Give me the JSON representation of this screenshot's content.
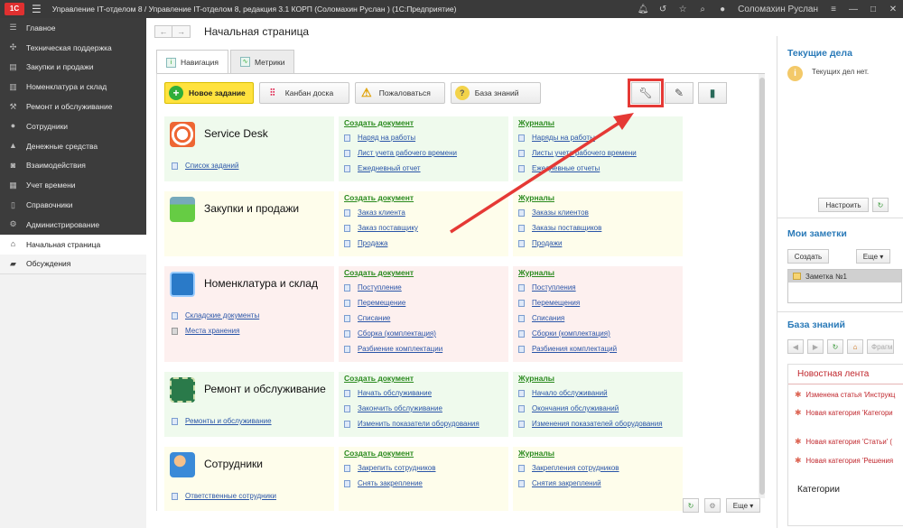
{
  "titlebar": {
    "logo": "1С",
    "title": "Управление IT-отделом 8 / Управление IT-отделом 8, редакция 3.1 КОРП (Соломахин Руслан ) (1С:Предприятие)",
    "user": "Соломахин Руслан",
    "icons": [
      "bell-icon",
      "history-icon",
      "star-icon",
      "search-icon",
      "user-icon",
      "menu-icon",
      "minimize-icon",
      "maximize-icon",
      "close-icon"
    ]
  },
  "sidebar": {
    "items": [
      {
        "label": "Главное",
        "icon": "list-icon"
      },
      {
        "label": "Техническая поддержка",
        "icon": "support-icon"
      },
      {
        "label": "Закупки и продажи",
        "icon": "cart-icon"
      },
      {
        "label": "Номенклатура и склад",
        "icon": "warehouse-icon"
      },
      {
        "label": "Ремонт и обслуживание",
        "icon": "wrench-icon"
      },
      {
        "label": "Сотрудники",
        "icon": "people-icon"
      },
      {
        "label": "Денежные средства",
        "icon": "money-icon"
      },
      {
        "label": "Взаимодействия",
        "icon": "interactions-icon"
      },
      {
        "label": "Учет времени",
        "icon": "calendar-icon"
      },
      {
        "label": "Справочники",
        "icon": "book-icon"
      },
      {
        "label": "Администрирование",
        "icon": "gear-icon"
      },
      {
        "label": "Начальная страница",
        "icon": "home-icon"
      },
      {
        "label": "Обсуждения",
        "icon": "chat-icon"
      }
    ]
  },
  "main": {
    "title": "Начальная страница",
    "tabs": [
      {
        "label": "Навигация"
      },
      {
        "label": "Метрики"
      }
    ],
    "toolbar": {
      "new_task": "Новое задание",
      "kanban": "Канбан доска",
      "complain": "Пожаловаться",
      "knowledge": "База знаний"
    },
    "tools": [
      "wrench-icon",
      "brush-icon",
      "book-icon"
    ],
    "create_doc": "Создать документ",
    "journals": "Журналы",
    "sections": [
      {
        "title": "Service Desk",
        "left_links": [
          "Список заданий"
        ],
        "docs": [
          "Наряд на работы",
          "Лист учета рабочего времени",
          "Ежедневный отчет"
        ],
        "journals": [
          "Наряды на работы",
          "Листы учета рабочего времени",
          "Ежедневные отчеты"
        ]
      },
      {
        "title": "Закупки и продажи",
        "left_links": [],
        "docs": [
          "Заказ клиента",
          "Заказ поставщику",
          "Продажа"
        ],
        "journals": [
          "Заказы клиентов",
          "Заказы поставщиков",
          "Продажи"
        ]
      },
      {
        "title": "Номенклатура и склад",
        "left_links": [
          "Складские документы",
          "Места хранения"
        ],
        "docs": [
          "Поступление",
          "Перемещение",
          "Списание",
          "Сборка (комплектация)",
          "Разбиение комплектации"
        ],
        "journals": [
          "Поступления",
          "Перемещения",
          "Списания",
          "Сборки (комплектация)",
          "Разбиения комплектаций"
        ]
      },
      {
        "title": "Ремонт и обслуживание",
        "left_links": [
          "Ремонты и обслуживание"
        ],
        "docs": [
          "Начать обслуживание",
          "Закончить обслуживание",
          "Изменить показатели оборудования"
        ],
        "journals": [
          "Начало обслуживаний",
          "Окончания обслуживаний",
          "Изменения показателей оборудования"
        ]
      },
      {
        "title": "Сотрудники",
        "left_links": [
          "Ответственные сотрудники"
        ],
        "docs": [
          "Закрепить сотрудников",
          "Снять закрепление"
        ],
        "journals": [
          "Закрепления сотрудников",
          "Снятия закреплений"
        ]
      }
    ],
    "bottom": {
      "more": "Еще ▾"
    }
  },
  "right": {
    "current_tasks": {
      "title": "Текущие дела",
      "empty": "Текущих дел нет.",
      "configure": "Настроить"
    },
    "notes": {
      "title": "Мои заметки",
      "create": "Создать",
      "more": "Еще ▾",
      "items": [
        "Заметка №1"
      ]
    },
    "kb": {
      "title": "База знаний",
      "search_placeholder": "Фрагм",
      "feed_title": "Новостная лента",
      "feed": [
        "Изменена статья 'Инструкц",
        "Новая категория 'Категори",
        "Новая категория 'Статьи' (",
        "Новая категория 'Решения"
      ],
      "categories": "Категории"
    }
  },
  "colors": {
    "accent": "#2a7ab8",
    "primary_button": "#ffe23e",
    "link": "#2a55a8",
    "section_header": "#2a8a1e",
    "arrow": "#e53935",
    "sidebar_bg": "#3c3c3c"
  }
}
